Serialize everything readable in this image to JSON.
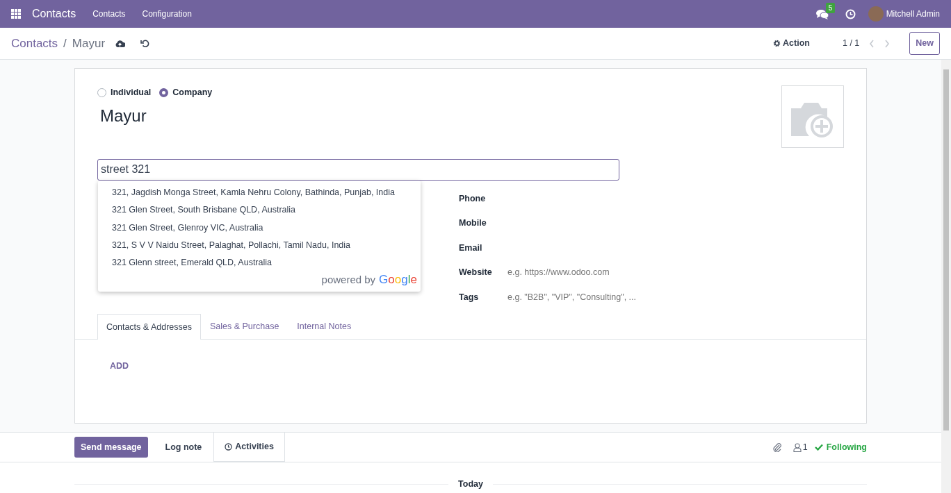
{
  "navbar": {
    "app": "Contacts",
    "menu": [
      "Contacts",
      "Configuration"
    ],
    "messages_count": "5",
    "user": "Mitchell Admin"
  },
  "control_panel": {
    "breadcrumb": [
      "Contacts",
      "Mayur"
    ],
    "breadcrumb_separator": "/",
    "action": "Action",
    "pager": "1 / 1",
    "new_button": "New"
  },
  "form": {
    "company_type": [
      {
        "label": "Individual",
        "selected": false
      },
      {
        "label": "Company",
        "selected": true
      }
    ],
    "name": "Mayur",
    "address": {
      "value": "street 321",
      "suggestions": [
        "321, Jagdish Monga Street, Kamla Nehru Colony, Bathinda, Punjab, India",
        "321 Glen Street, South Brisbane QLD, Australia",
        "321 Glen Street, Glenroy VIC, Australia",
        "321, S V V Naidu Street, Palaghat, Pollachi, Tamil Nadu, India",
        "321 Glenn street, Emerald QLD, Australia"
      ],
      "attribution": {
        "text": "powered by",
        "brand": "Google"
      }
    },
    "fields": [
      {
        "label": "Phone"
      },
      {
        "label": "Mobile"
      },
      {
        "label": "Email"
      },
      {
        "label": "Website",
        "placeholder": "e.g. https://www.odoo.com"
      },
      {
        "label": "Tags",
        "placeholder": "e.g. \"B2B\", \"VIP\", \"Consulting\", ..."
      }
    ],
    "tabs": [
      {
        "label": "Contacts & Addresses",
        "selected": true
      },
      {
        "label": "Sales & Purchase",
        "selected": false
      },
      {
        "label": "Internal Notes",
        "selected": false
      }
    ],
    "add_link": "ADD"
  },
  "chatter": {
    "buttons": [
      {
        "label": "Send message",
        "selected": true
      },
      {
        "label": "Log note",
        "selected": false
      }
    ],
    "activities": "Activities",
    "followers_count": "1",
    "following": "Following",
    "date_separator": "Today"
  }
}
